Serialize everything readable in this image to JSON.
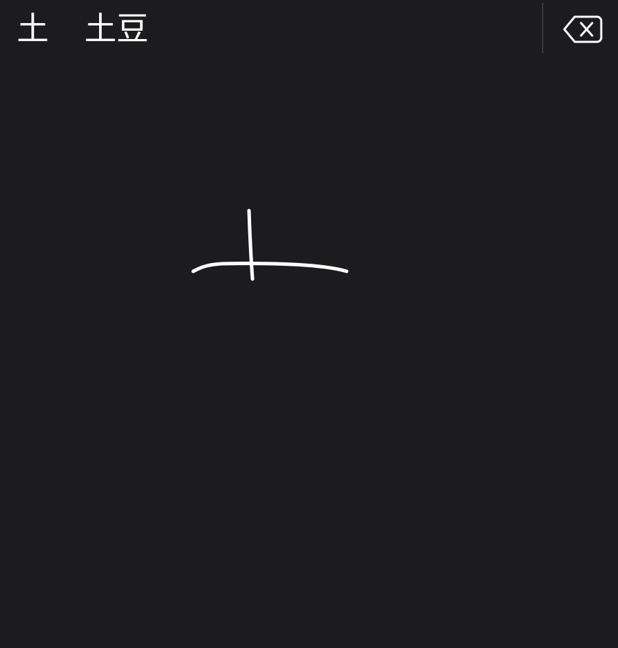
{
  "candidates": [
    {
      "text": "土"
    },
    {
      "text": "土豆"
    }
  ],
  "delete_key": {
    "icon": "delete-left-icon"
  },
  "handwriting": {
    "strokes": 2,
    "stroke_color": "#ffffff"
  },
  "colors": {
    "background": "#1c1c1e",
    "text": "#ffffff",
    "divider": "#3a3a3c"
  }
}
